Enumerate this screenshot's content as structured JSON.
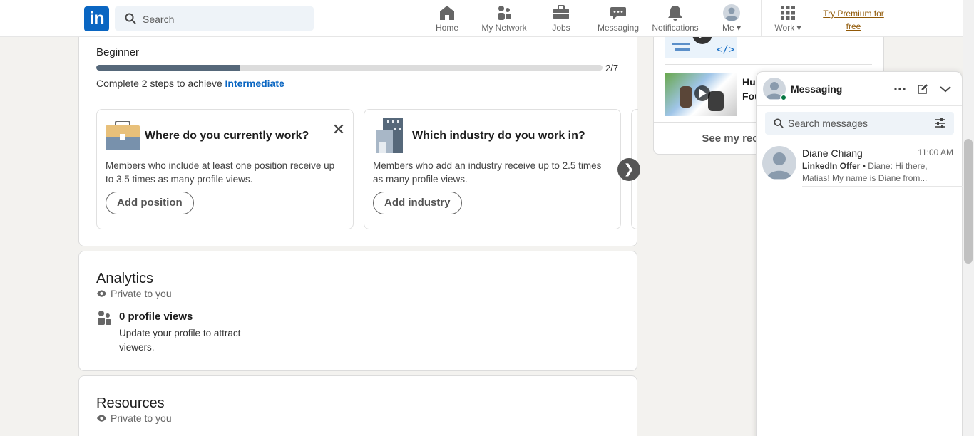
{
  "nav": {
    "logo_text": "in",
    "search_placeholder": "Search",
    "items": [
      {
        "label": "Home",
        "icon": "home-icon"
      },
      {
        "label": "My Network",
        "icon": "network-icon"
      },
      {
        "label": "Jobs",
        "icon": "briefcase-icon"
      },
      {
        "label": "Messaging",
        "icon": "chat-icon"
      },
      {
        "label": "Notifications",
        "icon": "bell-icon"
      },
      {
        "label": "Me",
        "icon": "avatar-icon"
      },
      {
        "label": "Work",
        "icon": "grid-icon"
      }
    ],
    "premium_line1": "Try Premium for",
    "premium_line2": "free"
  },
  "profile_progress": {
    "level": "Beginner",
    "progress_count": "2/7",
    "progress_fraction": 0.285,
    "steps_prefix": "Complete 2 steps to achieve ",
    "steps_target": "Intermediate",
    "cards": [
      {
        "title": "Where do you currently work?",
        "body": "Members who include at least one position receive up to 3.5 times as many profile views.",
        "button": "Add position"
      },
      {
        "title": "Which industry do you work in?",
        "body": "Members who add an industry receive up to 2.5 times as many profile views.",
        "button": "Add industry"
      }
    ]
  },
  "analytics": {
    "title": "Analytics",
    "privacy": "Private to you",
    "views_title": "0 profile views",
    "views_sub": "Update your profile to attract viewers."
  },
  "resources": {
    "title": "Resources",
    "privacy": "Private to you"
  },
  "sidebar": {
    "title_partial_1": "Hu",
    "title_partial_2": "Fou",
    "see_more_partial": "See my rec"
  },
  "messaging": {
    "title": "Messaging",
    "search_placeholder": "Search messages",
    "conversations": [
      {
        "name": "Diane Chiang",
        "time": "11:00 AM",
        "tag": "LinkedIn Offer •",
        "preview": "Diane: Hi there, Matias! My name is Diane from..."
      }
    ]
  },
  "colors": {
    "brand": "#0a66c2",
    "premium": "#915907",
    "online": "#057642",
    "progress_fill": "#56687a"
  }
}
